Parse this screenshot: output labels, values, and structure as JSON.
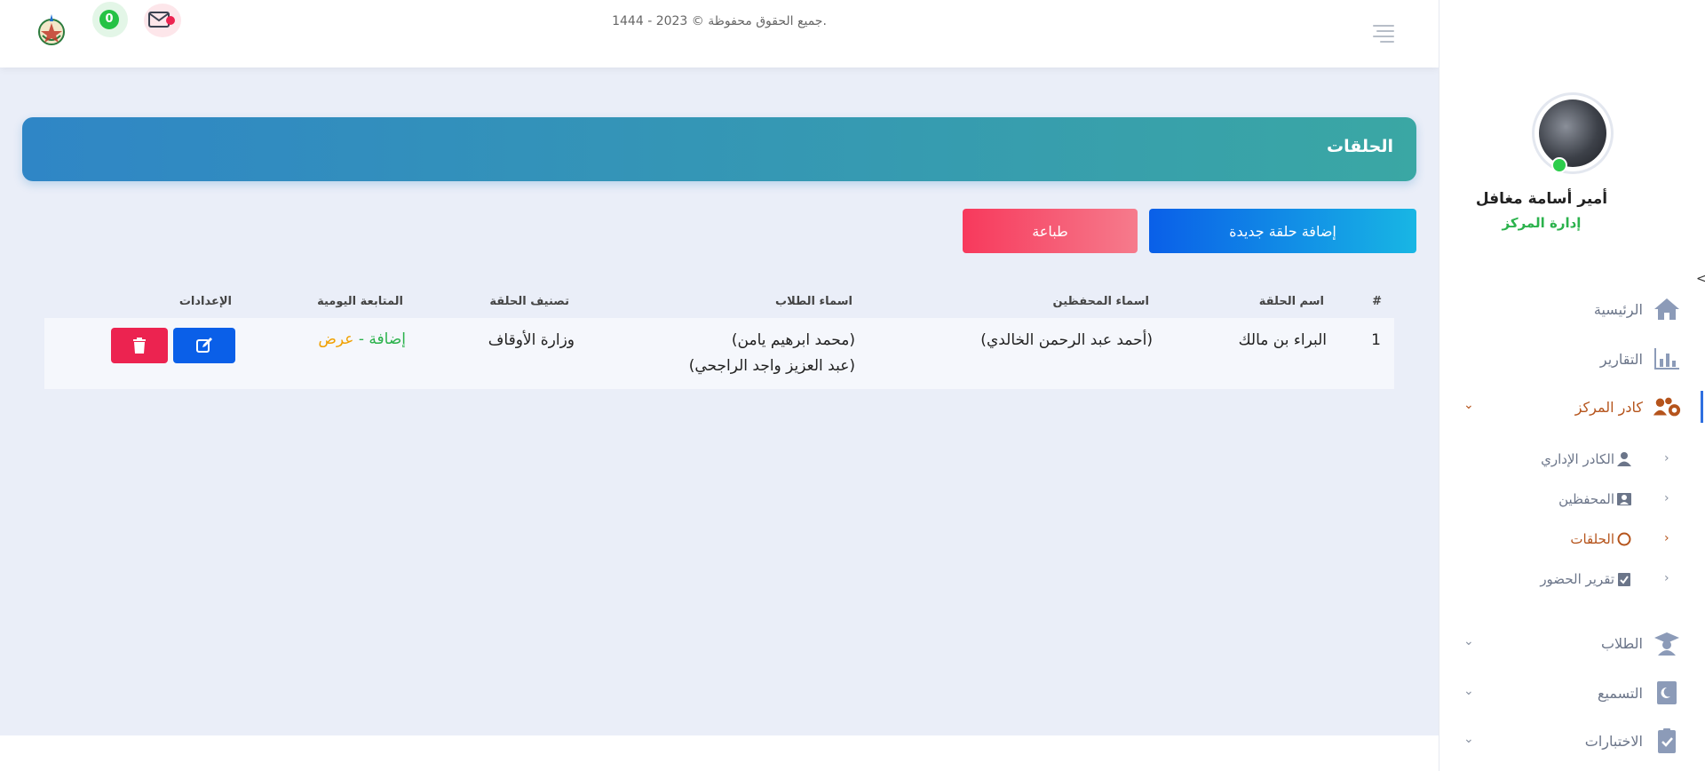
{
  "header": {
    "whatsapp_count": "0"
  },
  "user": {
    "name": "أمير أسامة مغافل",
    "role": "إدارة المركز"
  },
  "sidebar": {
    "collapse_glyph": "<",
    "items": [
      {
        "label": "الرئيسية",
        "icon": "home-icon"
      },
      {
        "label": "التقارير",
        "icon": "chart-icon"
      },
      {
        "label": "كادر المركز",
        "icon": "staff-gear-icon",
        "active": true
      },
      {
        "label": "الطلاب",
        "icon": "graduate-icon"
      },
      {
        "label": "التسميع",
        "icon": "quran-book-icon"
      },
      {
        "label": "الاختبارات",
        "icon": "clipboard-check-icon"
      }
    ],
    "subitems": [
      {
        "label": "الكادر الإداري",
        "icon": "admin-user-icon"
      },
      {
        "label": "المحفظين",
        "icon": "teacher-icon"
      },
      {
        "label": "الحلقات",
        "icon": "circle-icon",
        "active": true
      },
      {
        "label": "تقرير الحضور",
        "icon": "attendance-icon"
      }
    ]
  },
  "page": {
    "title": "الحلقات",
    "add_button": "إضافة حلقة جديدة",
    "print_button": "طباعة"
  },
  "table": {
    "headers": {
      "index": "#",
      "name": "اسم الحلقة",
      "teachers": "اسماء المحفظين",
      "students": "اسماء الطلاب",
      "category": "تصنيف الحلقة",
      "followup": "المتابعة اليومية",
      "settings": "الإعدادات"
    },
    "rows": [
      {
        "index": "1",
        "name": "البراء بن مالك",
        "teachers": "(أحمد عبد الرحمن الخالدي)",
        "students_line1": "(محمد ابرهيم يامن)",
        "students_line2": "(عبد العزيز واجد الراجحي)",
        "category": "وزارة الأوقاف",
        "followup_add": "إضافة",
        "followup_sep": " - ",
        "followup_view": "عرض"
      }
    ]
  },
  "footer": {
    "text": "جميع الحقوق محفوظة © 2023 - 1444."
  },
  "colors": {
    "banner_start": "#2f86c6",
    "banner_end": "#3aa7a4",
    "primary": "#0a5fe8",
    "danger": "#ec2350",
    "active_nav": "#b5541c",
    "success": "#2bb24c",
    "warning": "#f0a000"
  }
}
